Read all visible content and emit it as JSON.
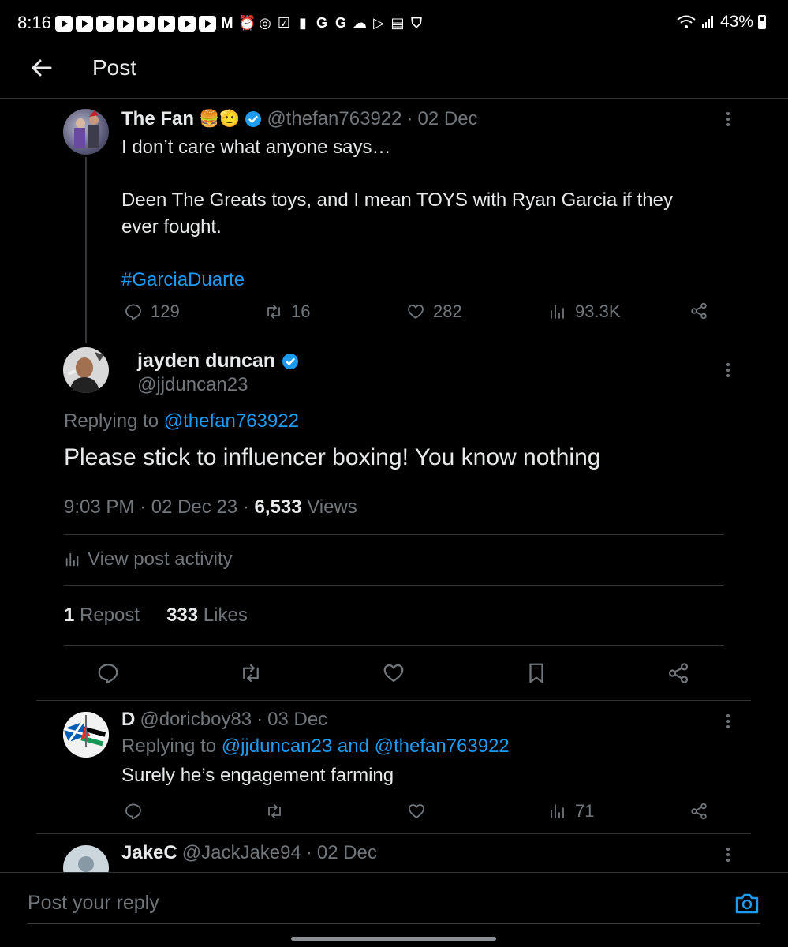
{
  "status_bar": {
    "time": "8:16",
    "battery": "43%"
  },
  "header": {
    "title": "Post"
  },
  "parent_tweet": {
    "name": "The Fan",
    "name_emoji": "🍔🫡",
    "handle": "@thefan763922",
    "date": "02 Dec",
    "separator": "·",
    "text_line1": "I don’t care what anyone says…",
    "text_line2": "Deen The Greats toys, and I mean TOYS with Ryan Garcia if they",
    "text_line3": "ever fought.",
    "hashtag": "#GarciaDuarte",
    "replies": "129",
    "reposts": "16",
    "likes": "282",
    "views": "93.3K"
  },
  "main_tweet": {
    "name": "jayden duncan",
    "handle": "@jjduncan23",
    "replying_prefix": "Replying to",
    "replying_to": "@thefan763922",
    "text": "Please stick to influencer boxing! You know nothing",
    "time": "9:03 PM",
    "date": "02 Dec 23",
    "views_count": "6,533",
    "views_label": "Views",
    "view_activity": "View post activity",
    "repost_count": "1",
    "repost_label": "Repost",
    "likes_count": "333",
    "likes_label": "Likes"
  },
  "reply1": {
    "name": "D",
    "handle": "@doricboy83",
    "date": "03 Dec",
    "replying_prefix": "Replying to",
    "replying_to": "@jjduncan23 and @thefan763922",
    "text": "Surely he’s engagement farming",
    "views": "71"
  },
  "reply2": {
    "name": "JakeC",
    "handle": "@JackJake94",
    "date": "02 Dec"
  },
  "reply_bar": {
    "placeholder": "Post your reply"
  },
  "colors": {
    "accent": "#1d9bf0",
    "muted": "#71767b",
    "background": "#000000",
    "divider": "#2f3336"
  }
}
